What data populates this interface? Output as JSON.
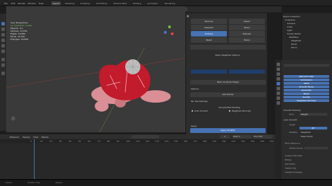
{
  "menu": {
    "file": "File",
    "edit": "Edit",
    "render": "Render",
    "window": "Window",
    "help": "Help"
  },
  "tabs": [
    "Layout",
    "Modeling",
    "Sculpting",
    "UV Editing",
    "Texture Paint",
    "Shading",
    "Animation",
    "Rendering"
  ],
  "stats": {
    "mode": "User Perspective",
    "collection": "(1) Collection | Cube",
    "objects_label": "Objects",
    "objects_value": "1/1",
    "vertices_label": "Vertices",
    "vertices_value": "12,532",
    "edges_label": "Edges",
    "edges_value": "24,862",
    "faces_label": "Faces",
    "faces_value": "12,432",
    "triangles_label": "Triangles",
    "triangles_value": "24,826"
  },
  "side_panel": {
    "tree_buttons": [
      [
        "Remove",
        "Select"
      ],
      [
        "Deselect",
        "Sharp"
      ],
      [
        "Unsharp",
        "Sharpen"
      ],
      [
        "Reset",
        "Sharp"
      ]
    ],
    "header": "Mesh Weighted Options",
    "mark_sharp": "Mark as Sharp Edges",
    "options": "Options",
    "add_extras": "Add Extras",
    "per_obj": "Per Obj Settings",
    "smooth_label": "Smooth/Flat Shading",
    "apply_button": "Apply Modifier",
    "auto_smooth": "Auto Smooth",
    "weighted": "Weighted Normals",
    "apply_label": "Apply"
  },
  "outliner": {
    "rows": [
      "Scene Collection",
      "Collection",
      "Camera",
      "Cube",
      "Light",
      "Sculpt_Detail",
      "Modifiers",
      "Weighted",
      "Bevel",
      "Mirror"
    ]
  },
  "properties": {
    "mods": [
      "Remesh Cube",
      "Subdivision",
      "Weld",
      "Smooth Faces",
      "Decimate",
      "Bevel",
      "Solidify",
      "Weighted Normals"
    ],
    "smooth_label": "Smooth Shading",
    "face_label": "Face",
    "face_value": "Weight",
    "auto_label": "Auto Smooth",
    "angle_label": "Angle",
    "angle_value": "30°",
    "modifier_label": "Modifier",
    "weighted_label": "Weighted",
    "keep_label": "Keep Sharp",
    "face_influence": "Face Influence",
    "vertex_label": "Vertex Group",
    "custom_label": "Custom Normals",
    "extras": "Extras",
    "geometry": "Geometry",
    "instancing": "Instancing",
    "viewport": "Viewport Display"
  },
  "timeline": {
    "playback": "Playback",
    "keying": "Keying",
    "view": "View",
    "marker": "Marker",
    "start_label": "Start",
    "start_value": "1",
    "end_label": "End",
    "end_value": "250",
    "current": "1",
    "ticks": [
      "0",
      "10",
      "20",
      "30",
      "40",
      "50",
      "60",
      "70",
      "80",
      "90",
      "100",
      "110",
      "120",
      "130",
      "140",
      "150",
      "160",
      "170",
      "180",
      "190",
      "200",
      "210",
      "220",
      "230",
      "240",
      "250"
    ]
  },
  "status": {
    "left": "Select",
    "mid": "Rotate View",
    "right": "Object"
  }
}
